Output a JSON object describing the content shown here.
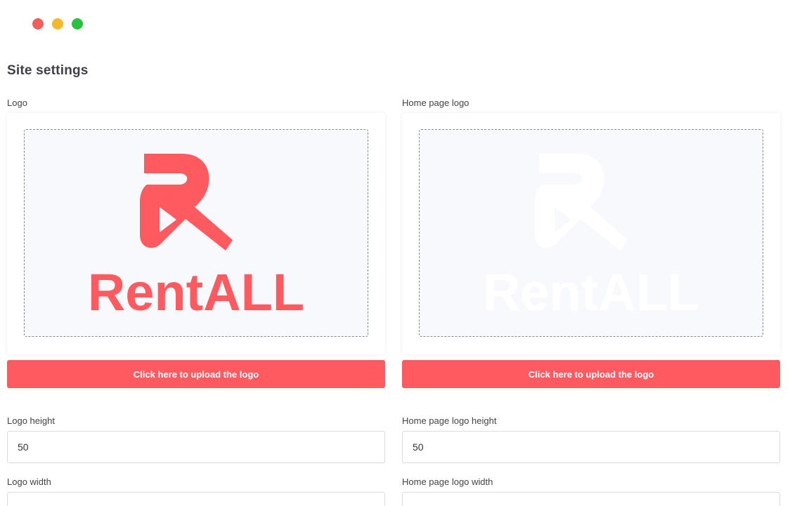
{
  "window": {
    "controls": [
      "close",
      "minimize",
      "maximize"
    ]
  },
  "page": {
    "title": "Site settings"
  },
  "logo": {
    "label": "Logo",
    "image_text": "RentALL",
    "image_color": "#ff5a5f",
    "upload_label": "Click here to upload the logo"
  },
  "home_logo": {
    "label": "Home page logo",
    "image_text": "RentALL",
    "image_color": "#ffffff",
    "upload_label": "Click here to upload the logo"
  },
  "fields": {
    "logo_height": {
      "label": "Logo height",
      "value": "50"
    },
    "home_logo_height": {
      "label": "Home page logo height",
      "value": "50"
    },
    "logo_width": {
      "label": "Logo width",
      "value": ""
    },
    "home_logo_width": {
      "label": "Home page logo width",
      "value": ""
    }
  },
  "colors": {
    "accent": "#ff5a5f",
    "dropzone_bg": "#f8f9fd"
  }
}
